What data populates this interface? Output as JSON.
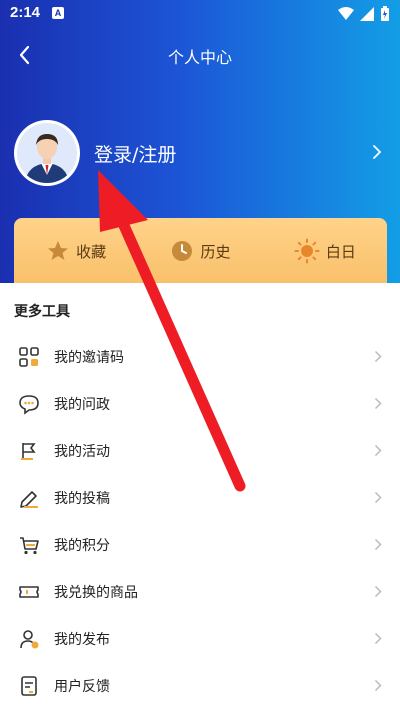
{
  "status_bar": {
    "time": "2:14",
    "app_badge": "A"
  },
  "nav": {
    "title": "个人中心",
    "back_icon": "chevron-left-icon"
  },
  "profile": {
    "login_label": "登录/注册",
    "avatar_icon": "user-avatar-icon"
  },
  "quick_actions": [
    {
      "label": "收藏",
      "icon": "star-icon"
    },
    {
      "label": "历史",
      "icon": "clock-icon"
    },
    {
      "label": "白日",
      "icon": "sun-icon"
    }
  ],
  "tools": {
    "title": "更多工具",
    "items": [
      {
        "label": "我的邀请码",
        "icon": "grid-icon"
      },
      {
        "label": "我的问政",
        "icon": "chat-icon"
      },
      {
        "label": "我的活动",
        "icon": "flag-icon"
      },
      {
        "label": "我的投稿",
        "icon": "pencil-icon"
      },
      {
        "label": "我的积分",
        "icon": "cart-icon"
      },
      {
        "label": "我兑换的商品",
        "icon": "ticket-icon"
      },
      {
        "label": "我的发布",
        "icon": "user-check-icon"
      },
      {
        "label": "用户反馈",
        "icon": "feedback-icon"
      }
    ]
  },
  "colors": {
    "header_start": "#1a2fb0",
    "header_end": "#139ee6",
    "card_start": "#ffd38a",
    "card_end": "#f9c06a",
    "accent_yellow": "#f2a93b",
    "arrow_red": "#ee1c25"
  }
}
